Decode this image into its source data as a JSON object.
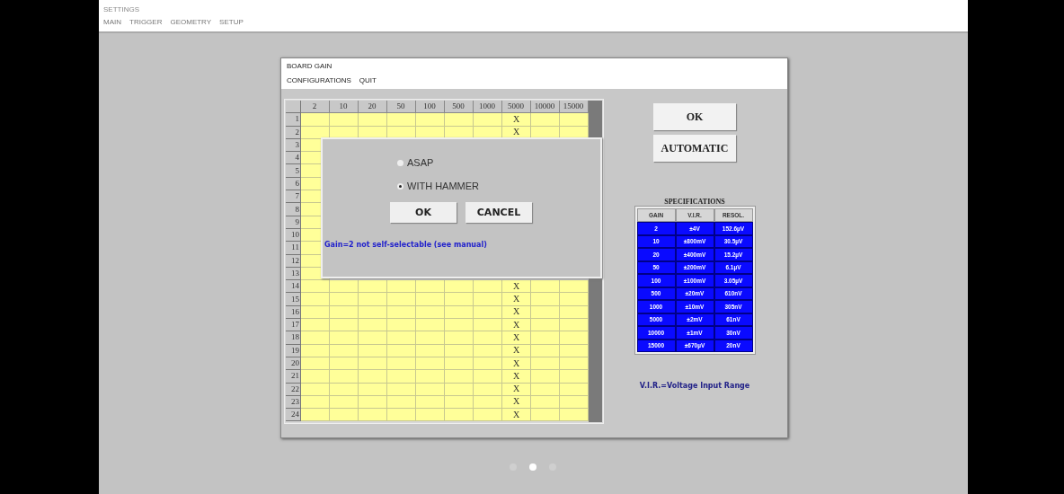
{
  "app": {
    "title": "SETTINGS",
    "menu": [
      "MAIN",
      "TRIGGER",
      "GEOMETRY",
      "SETUP"
    ]
  },
  "window": {
    "title": "BOARD GAIN",
    "menu": [
      "CONFIGURATIONS",
      "QUIT"
    ]
  },
  "grid": {
    "columns": [
      "2",
      "10",
      "20",
      "50",
      "100",
      "500",
      "1000",
      "5000",
      "10000",
      "15000"
    ],
    "rows": [
      {
        "number": "1",
        "cells": [
          {},
          {},
          {},
          {},
          {},
          {},
          {},
          {
            "text": "X"
          },
          {},
          {}
        ]
      },
      {
        "number": "2",
        "cells": [
          {},
          {},
          {},
          {},
          {},
          {},
          {},
          {
            "text": "X"
          },
          {},
          {}
        ]
      },
      {
        "number": "3",
        "cells": [
          {}
        ]
      },
      {
        "number": "4",
        "cells": [
          {}
        ]
      },
      {
        "number": "5",
        "cells": [
          {}
        ]
      },
      {
        "number": "6",
        "cells": [
          {}
        ]
      },
      {
        "number": "7",
        "cells": [
          {}
        ]
      },
      {
        "number": "8",
        "cells": [
          {}
        ]
      },
      {
        "number": "9",
        "cells": [
          {}
        ]
      },
      {
        "number": "10",
        "cells": [
          {}
        ]
      },
      {
        "number": "11",
        "cells": [
          {}
        ]
      },
      {
        "number": "12",
        "cells": [
          {}
        ]
      },
      {
        "number": "13",
        "cells": [
          {}
        ]
      },
      {
        "number": "14",
        "cells": [
          {},
          {},
          {},
          {},
          {},
          {},
          {},
          {
            "text": "X"
          },
          {},
          {}
        ]
      },
      {
        "number": "15",
        "cells": [
          {},
          {},
          {},
          {},
          {},
          {},
          {},
          {
            "text": "X"
          },
          {},
          {}
        ]
      },
      {
        "number": "16",
        "cells": [
          {},
          {},
          {},
          {},
          {},
          {},
          {},
          {
            "text": "X"
          },
          {},
          {}
        ]
      },
      {
        "number": "17",
        "cells": [
          {},
          {},
          {},
          {},
          {},
          {},
          {},
          {
            "text": "X"
          },
          {},
          {}
        ]
      },
      {
        "number": "18",
        "cells": [
          {},
          {},
          {},
          {},
          {},
          {},
          {},
          {
            "text": "X"
          },
          {},
          {}
        ]
      },
      {
        "number": "19",
        "cells": [
          {},
          {},
          {},
          {},
          {},
          {},
          {},
          {
            "text": "X"
          },
          {},
          {}
        ]
      },
      {
        "number": "20",
        "cells": [
          {},
          {},
          {},
          {},
          {},
          {},
          {},
          {
            "text": "X"
          },
          {},
          {}
        ]
      },
      {
        "number": "21",
        "cells": [
          {},
          {},
          {},
          {},
          {},
          {},
          {},
          {
            "text": "X"
          },
          {},
          {}
        ]
      },
      {
        "number": "22",
        "cells": [
          {},
          {},
          {},
          {},
          {},
          {},
          {},
          {
            "text": "X"
          },
          {},
          {}
        ]
      },
      {
        "number": "23",
        "cells": [
          {},
          {},
          {},
          {},
          {},
          {},
          {},
          {
            "text": "X"
          },
          {},
          {}
        ]
      },
      {
        "number": "24",
        "cells": [
          {},
          {},
          {},
          {},
          {},
          {},
          {},
          {
            "text": "X"
          },
          {},
          {}
        ]
      }
    ]
  },
  "dialog": {
    "options": [
      {
        "label": "ASAP",
        "selected": false
      },
      {
        "label": "WITH HAMMER",
        "selected": true
      }
    ],
    "buttons": [
      "OK",
      "CANCEL"
    ],
    "note": "Gain=2 not self-selectable (see manual)"
  },
  "buttons": [
    "OK",
    "AUTOMATIC"
  ],
  "specifications": {
    "title": "SPECIFICATIONS",
    "columns": [
      "GAIN",
      "V.I.R.",
      "RESOL."
    ],
    "rows": [
      [
        "2",
        "±4V",
        "152.6µV"
      ],
      [
        "10",
        "±800mV",
        "30.5µV"
      ],
      [
        "20",
        "±400mV",
        "15.2µV"
      ],
      [
        "50",
        "±200mV",
        "6.1µV"
      ],
      [
        "100",
        "±100mV",
        "3.05µV"
      ],
      [
        "500",
        "±20mV",
        "610nV"
      ],
      [
        "1000",
        "±10mV",
        "305nV"
      ],
      [
        "5000",
        "±2mV",
        "61nV"
      ],
      [
        "10000",
        "±1mV",
        "30nV"
      ],
      [
        "15000",
        "±670µV",
        "20nV"
      ]
    ]
  },
  "legend": "V.I.R.=Voltage Input Range",
  "pager": [
    {
      "selected": false
    },
    {
      "selected": true
    },
    {
      "selected": false
    }
  ]
}
